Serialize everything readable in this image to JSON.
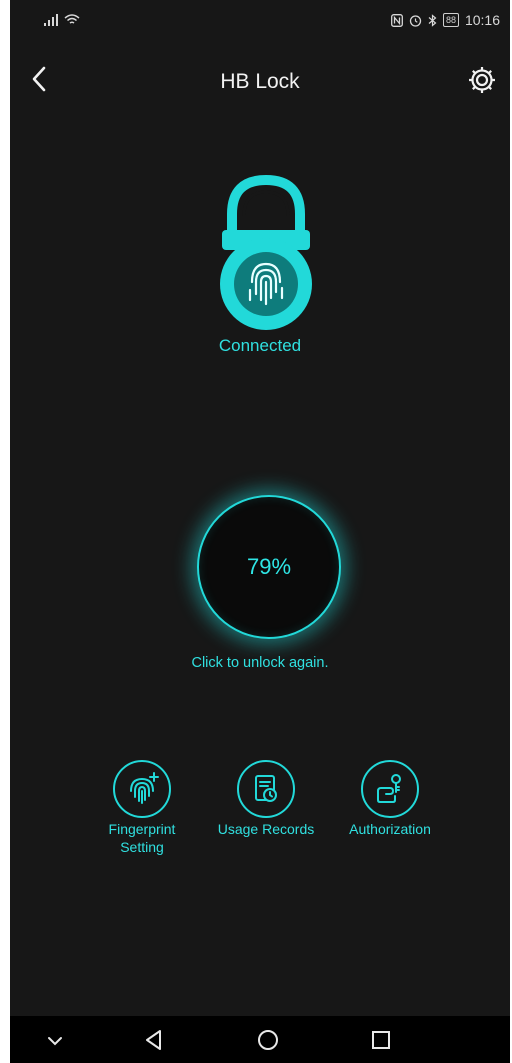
{
  "status_bar": {
    "battery": "88",
    "time": "10:16"
  },
  "header": {
    "title": "HB Lock"
  },
  "lock": {
    "status": "Connected"
  },
  "unlock": {
    "progress": "79%",
    "hint": "Click to unlock again."
  },
  "actions": [
    {
      "label": "Fingerprint Setting",
      "icon": "fingerprint-add-icon"
    },
    {
      "label": "Usage Records",
      "icon": "records-icon"
    },
    {
      "label": "Authorization",
      "icon": "authorization-icon"
    }
  ],
  "colors": {
    "accent": "#22d9d9",
    "background": "#171717",
    "text": "#f2f2f2"
  }
}
